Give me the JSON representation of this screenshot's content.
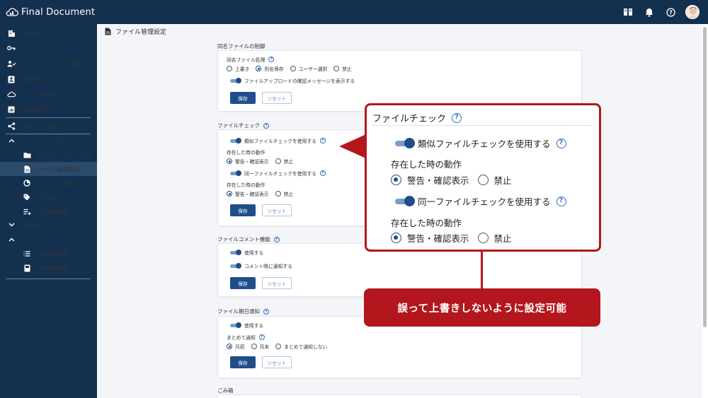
{
  "app": {
    "title": "Final Document"
  },
  "sidebar": {
    "items": [
      {
        "label": "会社設定",
        "icon": "building-icon"
      },
      {
        "label": "セキュリティ",
        "icon": "key-icon"
      },
      {
        "label": "グループ・ユーザー管理",
        "icon": "users-icon"
      },
      {
        "label": "役職管理",
        "icon": "badge-icon"
      },
      {
        "label": "システム連携",
        "icon": "cloud-icon"
      },
      {
        "label": "管理者ログ",
        "icon": "log-icon"
      },
      {
        "label": "共有リンク設定",
        "icon": "share-icon"
      },
      {
        "label": "ファイル・キャビネット",
        "icon": "chevron-up-icon"
      },
      {
        "label": "共有キャビネット管理",
        "icon": "folder-icon"
      },
      {
        "label": "ファイル管理設定",
        "icon": "file-icon"
      },
      {
        "label": "ストレージ管理",
        "icon": "storage-icon"
      },
      {
        "label": "タグ管理",
        "icon": "tag-icon"
      },
      {
        "label": "付加情報管理",
        "icon": "list-add-icon"
      },
      {
        "label": "電帳法",
        "icon": "chevron-down-icon"
      },
      {
        "label": "ワークフロー",
        "icon": "chevron-up-icon"
      },
      {
        "label": "任意項目管理",
        "icon": "list-icon"
      },
      {
        "label": "文書種別管理",
        "icon": "book-icon"
      }
    ]
  },
  "page": {
    "title": "ファイル管理設定"
  },
  "sections": {
    "same_name": {
      "title": "同名ファイルの制御",
      "process_label": "同名ファイル処理",
      "options": [
        "上書き",
        "別名保存",
        "ユーザー選択",
        "禁止"
      ],
      "selected": "別名保存",
      "confirm_toggle": "ファイルアップロードの確認メッセージを表示する"
    },
    "file_check": {
      "title": "ファイルチェック",
      "similar_toggle": "類似ファイルチェックを使用する",
      "action_label": "存在した時の動作",
      "action_options": [
        "警告・確認表示",
        "禁止"
      ],
      "same_toggle": "同一ファイルチェックを使用する",
      "action_label2": "存在した時の動作"
    },
    "comment": {
      "title": "ファイルコメント機能",
      "use_toggle": "使用する",
      "notify_toggle": "コメント時に通知する"
    },
    "deadline": {
      "title": "ファイル期日通知",
      "use_toggle": "使用する",
      "group_label": "まとめて通知",
      "options": [
        "月初",
        "月末",
        "まとめて通知しない"
      ]
    },
    "trash": {
      "title": "ごみ箱"
    }
  },
  "buttons": {
    "save": "保存",
    "reset": "リセット"
  },
  "callout": {
    "message": "誤って上書きしないように設定可能"
  },
  "colors": {
    "nav": "#14304f",
    "primary": "#1f4f8a",
    "callout": "#b3161d"
  }
}
